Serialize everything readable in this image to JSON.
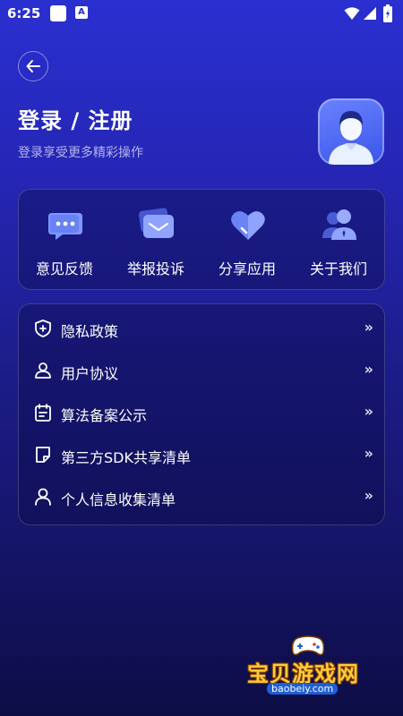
{
  "status_bar": {
    "time": "6:25",
    "notif_letter": "A"
  },
  "header": {
    "title": "登录 / 注册",
    "subtitle": "登录享受更多精彩操作"
  },
  "quick_actions": [
    {
      "label": "意见反馈",
      "icon": "chat-bubble-icon"
    },
    {
      "label": "举报投诉",
      "icon": "mail-icon"
    },
    {
      "label": "分享应用",
      "icon": "heart-icon"
    },
    {
      "label": "关于我们",
      "icon": "team-icon"
    }
  ],
  "menu": [
    {
      "label": "隐私政策",
      "icon": "shield-plus-icon",
      "chevron": "»"
    },
    {
      "label": "用户协议",
      "icon": "user-stamp-icon",
      "chevron": "»"
    },
    {
      "label": "算法备案公示",
      "icon": "calendar-icon",
      "chevron": "»"
    },
    {
      "label": "第三方SDK共享清单",
      "icon": "folded-page-icon",
      "chevron": "»"
    },
    {
      "label": "个人信息收集清单",
      "icon": "person-icon",
      "chevron": "»"
    }
  ],
  "watermark": {
    "title": "宝贝游戏网",
    "url": "baobeiy.com"
  },
  "colors": {
    "accent": "#2a2fd0",
    "card_bg": "#15156a",
    "icon_light": "#8fa3ff",
    "watermark_yellow": "#ffcb3a"
  }
}
